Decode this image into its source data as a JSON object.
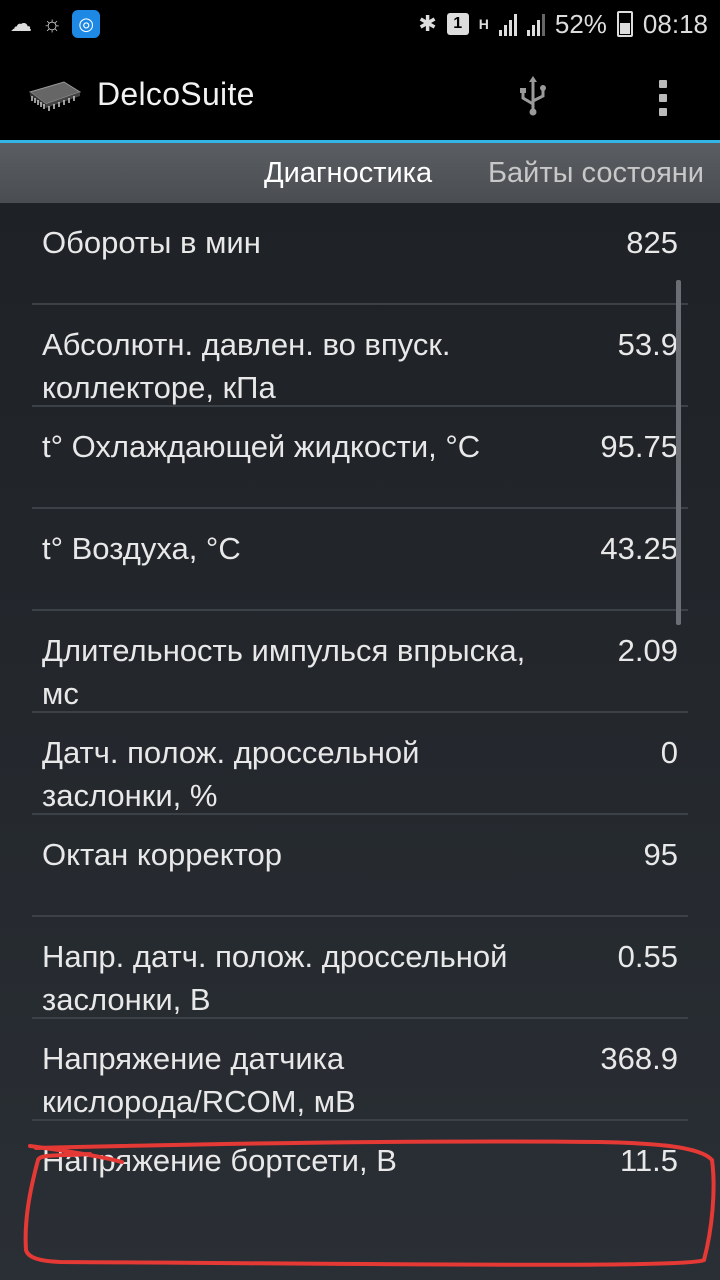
{
  "status_bar": {
    "battery_text": "52%",
    "time": "08:18",
    "sim_label": "1",
    "network_type": "H",
    "icons": [
      "cloud-icon",
      "weather-icon",
      "app-notification-icon",
      "bluetooth-icon",
      "sim-icon",
      "signal-icon",
      "signal-icon",
      "battery-icon"
    ]
  },
  "action_bar": {
    "title": "DelcoSuite",
    "icons": [
      "chip-logo-icon",
      "usb-icon",
      "overflow-menu-icon"
    ]
  },
  "tabs": [
    {
      "label": "Диагностика",
      "active": true
    },
    {
      "label": "Байты состояни",
      "active": false
    }
  ],
  "rows": [
    {
      "label": "Обороты в мин",
      "value": "825"
    },
    {
      "label": "Абсолютн. давлен. во впуск. коллекторе, кПа",
      "value": "53.9"
    },
    {
      "label": "t° Охлаждающей жидкости, °C",
      "value": "95.75"
    },
    {
      "label": "t° Воздуха, °C",
      "value": "43.25"
    },
    {
      "label": "Длительность импулься впрыска, мс",
      "value": "2.09"
    },
    {
      "label": "Датч. полож. дроссельной заслонки, %",
      "value": "0"
    },
    {
      "label": "Октан корректор",
      "value": "95"
    },
    {
      "label": "Напр. датч. полож. дроссельной заслонки, В",
      "value": "0.55"
    },
    {
      "label": "Напряжение датчика кислорода/RCOM, мВ",
      "value": "368.9"
    },
    {
      "label": "Напряжение бортсети, В",
      "value": "11.5"
    }
  ],
  "colors": {
    "accent": "#33b5e5",
    "highlight_annotation": "#e53935"
  }
}
